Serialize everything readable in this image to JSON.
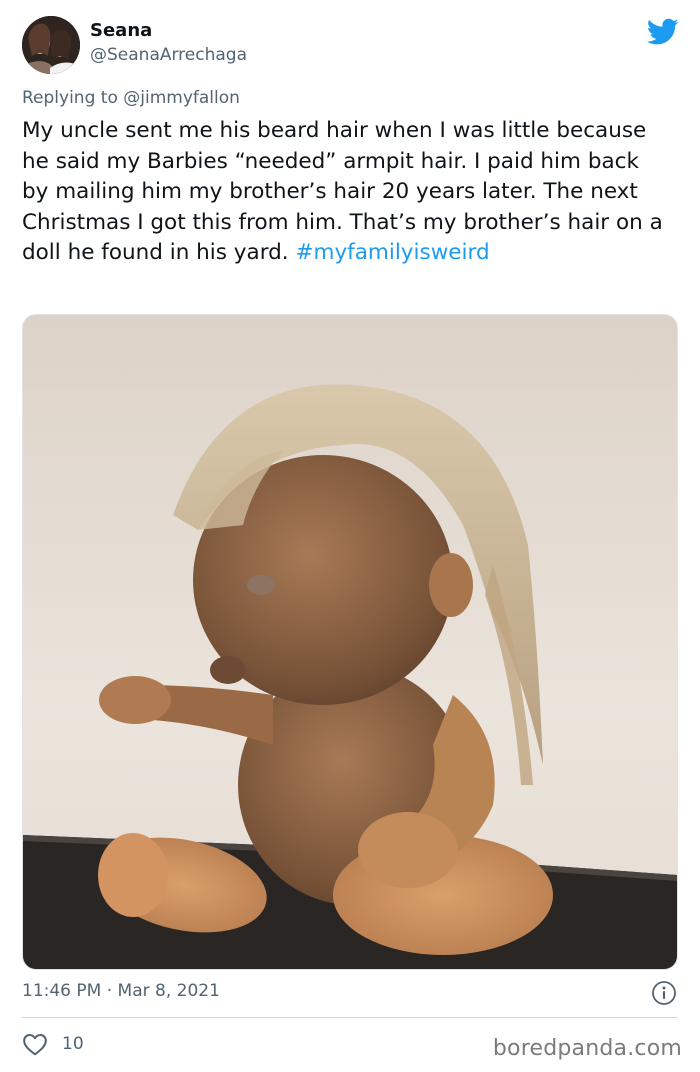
{
  "tweet": {
    "author": {
      "display_name": "Seana",
      "handle": "@SeanaArrechaga",
      "avatar_icon": "profile-photo"
    },
    "reply_prefix": "Replying to",
    "reply_to": "@jimmyfallon",
    "text": "My uncle sent me his beard hair when I was little because he said my Barbies “needed” armpit hair. I paid him back by mailing him my brother’s hair 20 years later. The next Christmas I got this from him. That’s my brother’s hair on a doll he found in his yard.",
    "hashtag": "#myfamilyisweird",
    "timestamp": "11:46 PM · Mar 8, 2021",
    "like_count": "10"
  },
  "watermark": "boredpanda.com",
  "colors": {
    "brand": "#1d9bf0",
    "text_primary": "#0f1419",
    "text_secondary": "#536471",
    "divider": "#cfd9de"
  },
  "icons": {
    "brand": "twitter-bird-icon",
    "info": "info-icon",
    "like": "heart-icon"
  }
}
